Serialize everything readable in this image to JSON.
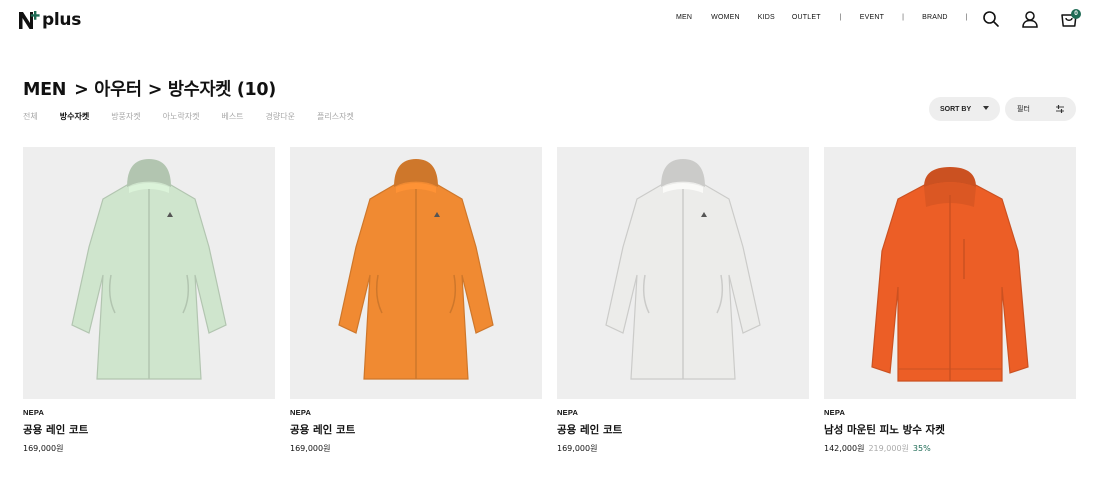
{
  "header": {
    "logo_text": "plus",
    "nav": [
      "MEN",
      "WOMEN",
      "KIDS",
      "OUTLET",
      "|",
      "EVENT",
      "|",
      "BRAND",
      "|"
    ],
    "cart_count": "0",
    "accent": "#1e6b55"
  },
  "page": {
    "title_category": "MEN",
    "title_sub1": "> 아우터",
    "title_sub2": "> 방수자켓 (10)"
  },
  "subtabs": [
    {
      "label": "전체",
      "active": false
    },
    {
      "label": "방수자켓",
      "active": true
    },
    {
      "label": "방풍자켓",
      "active": false
    },
    {
      "label": "아노락자켓",
      "active": false
    },
    {
      "label": "베스트",
      "active": false
    },
    {
      "label": "경량다운",
      "active": false
    },
    {
      "label": "플리스자켓",
      "active": false
    }
  ],
  "toolbar": {
    "sort_label": "SORT BY",
    "filter_label": "필터"
  },
  "products": [
    {
      "brand": "NEPA",
      "name": "공용 레인 코트",
      "price": "169,000원",
      "original_price": "",
      "discount": "",
      "color": "#cfe5cd",
      "style": "coat"
    },
    {
      "brand": "NEPA",
      "name": "공용 레인 코트",
      "price": "169,000원",
      "original_price": "",
      "discount": "",
      "color": "#f08a32",
      "style": "coat"
    },
    {
      "brand": "NEPA",
      "name": "공용 레인 코트",
      "price": "169,000원",
      "original_price": "",
      "discount": "",
      "color": "#ececea",
      "style": "coat"
    },
    {
      "brand": "NEPA",
      "name": "남성 마운틴 피노 방수 자켓",
      "price": "142,000원",
      "original_price": "219,000원",
      "discount": "35%",
      "color": "#ec5e26",
      "style": "jacket"
    }
  ]
}
